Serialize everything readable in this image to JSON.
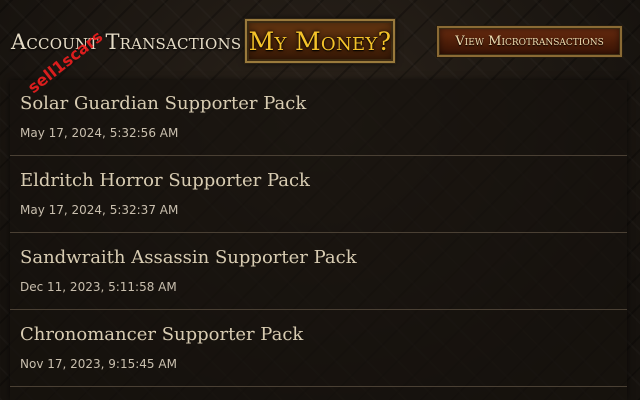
{
  "header": {
    "title": "Account Transactions",
    "my_money_label": "My Money?",
    "view_micro_label": "View Microtransactions"
  },
  "transactions": [
    {
      "name": "Solar Guardian Supporter Pack",
      "date": "May 17, 2024, 5:32:56 AM"
    },
    {
      "name": "Eldritch Horror Supporter Pack",
      "date": "May 17, 2024, 5:32:37 AM"
    },
    {
      "name": "Sandwraith Assassin Supporter Pack",
      "date": "Dec 11, 2023, 5:11:58 AM"
    },
    {
      "name": "Chronomancer Supporter Pack",
      "date": "Nov 17, 2023, 9:15:45 AM"
    }
  ],
  "watermark": "sell1scars",
  "colors": {
    "background": "#1c1712",
    "title_text": "#e6dcc6",
    "money_button_text": "#f5c32a",
    "button_border": "#9a7a3c",
    "item_title": "#d8ccb2",
    "item_date": "#c9bfae",
    "watermark": "#eb1e1e"
  }
}
